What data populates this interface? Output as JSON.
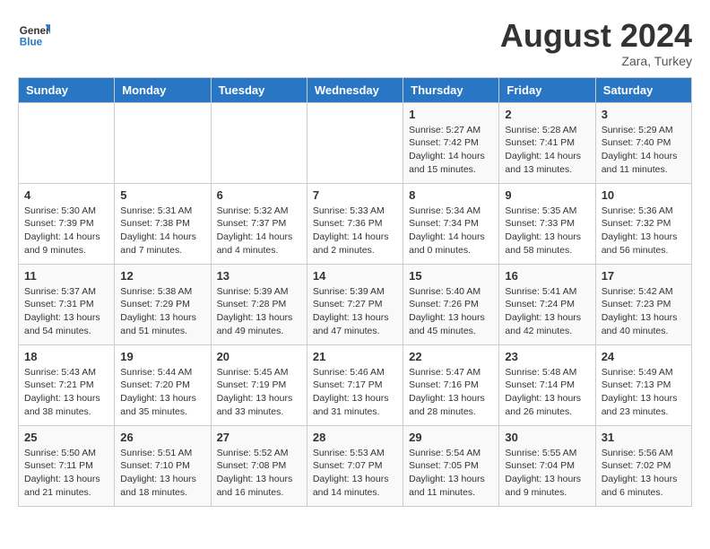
{
  "header": {
    "logo_line1": "General",
    "logo_line2": "Blue",
    "month_year": "August 2024",
    "location": "Zara, Turkey"
  },
  "days_of_week": [
    "Sunday",
    "Monday",
    "Tuesday",
    "Wednesday",
    "Thursday",
    "Friday",
    "Saturday"
  ],
  "weeks": [
    [
      {
        "day": "",
        "info": ""
      },
      {
        "day": "",
        "info": ""
      },
      {
        "day": "",
        "info": ""
      },
      {
        "day": "",
        "info": ""
      },
      {
        "day": "1",
        "info": "Sunrise: 5:27 AM\nSunset: 7:42 PM\nDaylight: 14 hours\nand 15 minutes."
      },
      {
        "day": "2",
        "info": "Sunrise: 5:28 AM\nSunset: 7:41 PM\nDaylight: 14 hours\nand 13 minutes."
      },
      {
        "day": "3",
        "info": "Sunrise: 5:29 AM\nSunset: 7:40 PM\nDaylight: 14 hours\nand 11 minutes."
      }
    ],
    [
      {
        "day": "4",
        "info": "Sunrise: 5:30 AM\nSunset: 7:39 PM\nDaylight: 14 hours\nand 9 minutes."
      },
      {
        "day": "5",
        "info": "Sunrise: 5:31 AM\nSunset: 7:38 PM\nDaylight: 14 hours\nand 7 minutes."
      },
      {
        "day": "6",
        "info": "Sunrise: 5:32 AM\nSunset: 7:37 PM\nDaylight: 14 hours\nand 4 minutes."
      },
      {
        "day": "7",
        "info": "Sunrise: 5:33 AM\nSunset: 7:36 PM\nDaylight: 14 hours\nand 2 minutes."
      },
      {
        "day": "8",
        "info": "Sunrise: 5:34 AM\nSunset: 7:34 PM\nDaylight: 14 hours\nand 0 minutes."
      },
      {
        "day": "9",
        "info": "Sunrise: 5:35 AM\nSunset: 7:33 PM\nDaylight: 13 hours\nand 58 minutes."
      },
      {
        "day": "10",
        "info": "Sunrise: 5:36 AM\nSunset: 7:32 PM\nDaylight: 13 hours\nand 56 minutes."
      }
    ],
    [
      {
        "day": "11",
        "info": "Sunrise: 5:37 AM\nSunset: 7:31 PM\nDaylight: 13 hours\nand 54 minutes."
      },
      {
        "day": "12",
        "info": "Sunrise: 5:38 AM\nSunset: 7:29 PM\nDaylight: 13 hours\nand 51 minutes."
      },
      {
        "day": "13",
        "info": "Sunrise: 5:39 AM\nSunset: 7:28 PM\nDaylight: 13 hours\nand 49 minutes."
      },
      {
        "day": "14",
        "info": "Sunrise: 5:39 AM\nSunset: 7:27 PM\nDaylight: 13 hours\nand 47 minutes."
      },
      {
        "day": "15",
        "info": "Sunrise: 5:40 AM\nSunset: 7:26 PM\nDaylight: 13 hours\nand 45 minutes."
      },
      {
        "day": "16",
        "info": "Sunrise: 5:41 AM\nSunset: 7:24 PM\nDaylight: 13 hours\nand 42 minutes."
      },
      {
        "day": "17",
        "info": "Sunrise: 5:42 AM\nSunset: 7:23 PM\nDaylight: 13 hours\nand 40 minutes."
      }
    ],
    [
      {
        "day": "18",
        "info": "Sunrise: 5:43 AM\nSunset: 7:21 PM\nDaylight: 13 hours\nand 38 minutes."
      },
      {
        "day": "19",
        "info": "Sunrise: 5:44 AM\nSunset: 7:20 PM\nDaylight: 13 hours\nand 35 minutes."
      },
      {
        "day": "20",
        "info": "Sunrise: 5:45 AM\nSunset: 7:19 PM\nDaylight: 13 hours\nand 33 minutes."
      },
      {
        "day": "21",
        "info": "Sunrise: 5:46 AM\nSunset: 7:17 PM\nDaylight: 13 hours\nand 31 minutes."
      },
      {
        "day": "22",
        "info": "Sunrise: 5:47 AM\nSunset: 7:16 PM\nDaylight: 13 hours\nand 28 minutes."
      },
      {
        "day": "23",
        "info": "Sunrise: 5:48 AM\nSunset: 7:14 PM\nDaylight: 13 hours\nand 26 minutes."
      },
      {
        "day": "24",
        "info": "Sunrise: 5:49 AM\nSunset: 7:13 PM\nDaylight: 13 hours\nand 23 minutes."
      }
    ],
    [
      {
        "day": "25",
        "info": "Sunrise: 5:50 AM\nSunset: 7:11 PM\nDaylight: 13 hours\nand 21 minutes."
      },
      {
        "day": "26",
        "info": "Sunrise: 5:51 AM\nSunset: 7:10 PM\nDaylight: 13 hours\nand 18 minutes."
      },
      {
        "day": "27",
        "info": "Sunrise: 5:52 AM\nSunset: 7:08 PM\nDaylight: 13 hours\nand 16 minutes."
      },
      {
        "day": "28",
        "info": "Sunrise: 5:53 AM\nSunset: 7:07 PM\nDaylight: 13 hours\nand 14 minutes."
      },
      {
        "day": "29",
        "info": "Sunrise: 5:54 AM\nSunset: 7:05 PM\nDaylight: 13 hours\nand 11 minutes."
      },
      {
        "day": "30",
        "info": "Sunrise: 5:55 AM\nSunset: 7:04 PM\nDaylight: 13 hours\nand 9 minutes."
      },
      {
        "day": "31",
        "info": "Sunrise: 5:56 AM\nSunset: 7:02 PM\nDaylight: 13 hours\nand 6 minutes."
      }
    ]
  ]
}
